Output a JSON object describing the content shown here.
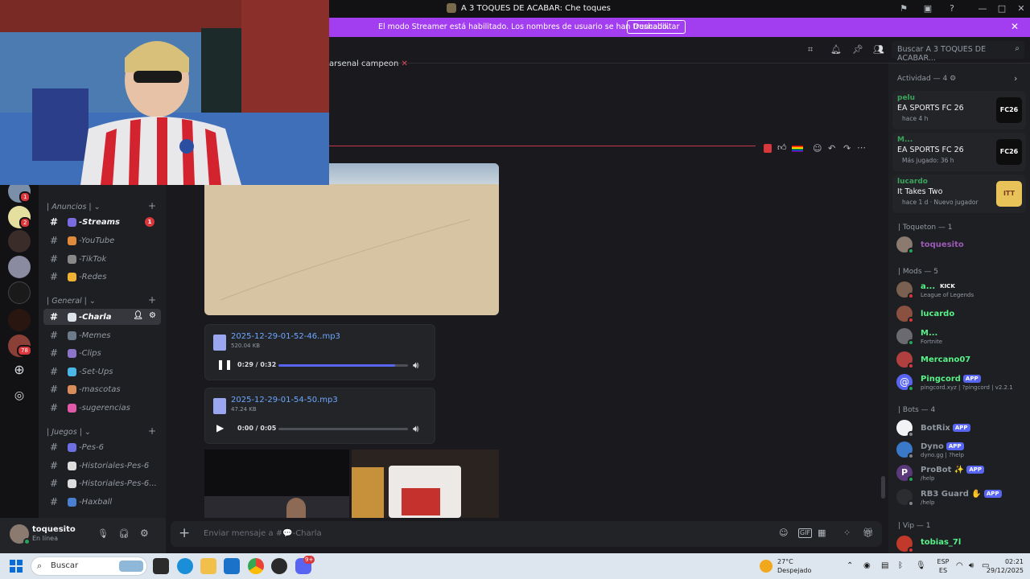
{
  "window": {
    "title": "A 3 TOQUES DE ACABAR: Che toques"
  },
  "streamer_bar": {
    "message": "El modo Streamer está habilitado. Los nombres de usuario se han truncado.",
    "button": "Deshabilitar"
  },
  "header": {
    "search_placeholder": "Buscar A 3 TOQUES DE ACABAR..."
  },
  "servers": {
    "badges": [
      "1",
      "2",
      "78"
    ]
  },
  "channels": {
    "categories": [
      {
        "name": "| Anuncios |",
        "items": [
          {
            "label": "-Streams",
            "badge": "1",
            "color": "#7a6be0"
          },
          {
            "label": "-YouTube",
            "color": "#e08a3c"
          },
          {
            "label": "-TikTok",
            "color": "#888"
          },
          {
            "label": "-Redes",
            "color": "#f0b232"
          }
        ]
      },
      {
        "name": "| General |",
        "items": [
          {
            "label": "-Charla",
            "color": "#dfe3ea"
          },
          {
            "label": "-Memes",
            "color": "#6d7a8a"
          },
          {
            "label": "-Clips",
            "color": "#8c74c9"
          },
          {
            "label": "-Set-Ups",
            "color": "#4bb6e8"
          },
          {
            "label": "-mascotas",
            "color": "#d98d5b"
          },
          {
            "label": "-sugerencias",
            "color": "#e05aa8"
          }
        ]
      },
      {
        "name": "| Juegos |",
        "items": [
          {
            "label": "-Pes-6",
            "color": "#6d6fe0"
          },
          {
            "label": "-Historiales-Pes-6",
            "color": "#ddd"
          },
          {
            "label": "-Historiales-Pes-6...",
            "color": "#ddd"
          },
          {
            "label": "-Haxball",
            "color": "#4a7fd1"
          }
        ]
      }
    ]
  },
  "user_panel": {
    "name": "toquesito",
    "status": "En línea"
  },
  "chat": {
    "partial_message": "arsenal campeon",
    "attachments": [
      {
        "filename": "2025-12-29-01-52-46..mp3",
        "size": "520.04 KB",
        "time": "0:29 / 0:32",
        "progress": 0.9,
        "playing": true
      },
      {
        "filename": "2025-12-29-01-54-50.mp3",
        "size": "47.24 KB",
        "time": "0:00 / 0:05",
        "progress": 0.0,
        "playing": false
      }
    ],
    "composer_placeholder": "Enviar mensaje a #💬-Charla"
  },
  "members": {
    "activity_header": "Actividad — 4",
    "activities": [
      {
        "name": "pelu",
        "game": "EA SPORTS FC 26",
        "sub": "hace 4 h",
        "art": "FC26"
      },
      {
        "name": "M...",
        "game": "EA SPORTS FC 26",
        "sub": "Más jugado: 36 h",
        "art": "FC26"
      },
      {
        "name": "lucardo",
        "game": "It Takes Two",
        "sub": "hace 1 d  · Nuevo jugador",
        "art": "ITT"
      }
    ],
    "groups": [
      {
        "title": "| Toqueton — 1",
        "members": [
          {
            "name": "toquesito",
            "color": "#9b59b6"
          }
        ]
      },
      {
        "title": "| Mods — 5",
        "members": [
          {
            "name": "a...",
            "tag": "KICK",
            "sub": "League of Legends",
            "color": "#57f287"
          },
          {
            "name": "lucardo",
            "color": "#57f287"
          },
          {
            "name": "M...",
            "sub": "Fortnite",
            "color": "#57f287"
          },
          {
            "name": "Mercano07",
            "color": "#57f287"
          },
          {
            "name": "Pingcord",
            "tag": "APP",
            "sub": "pingcord.xyz | ?pingcord | v2.2.1",
            "color": "#57f287"
          }
        ]
      },
      {
        "title": "| Bots — 4",
        "members": [
          {
            "name": "BotRix",
            "tag": "APP",
            "color": "#8f96a0"
          },
          {
            "name": "Dyno",
            "tag": "APP",
            "sub": "dyno.gg | ?help",
            "color": "#8f96a0"
          },
          {
            "name": "ProBot ✨",
            "tag": "APP",
            "sub": "/help",
            "color": "#8f96a0"
          },
          {
            "name": "RB3 Guard ✋",
            "tag": "APP",
            "sub": "/help",
            "color": "#8f96a0"
          }
        ]
      },
      {
        "title": "| Vip — 1",
        "members": [
          {
            "name": "tobias_7l",
            "color": "#57f287"
          }
        ]
      }
    ]
  },
  "taskbar": {
    "search": "Buscar",
    "weather_temp": "27°C",
    "weather_desc": "Despejado",
    "lang": "ESP",
    "lang2": "ES",
    "time": "02:21",
    "date": "29/12/2025",
    "discord_badge": "9+"
  }
}
